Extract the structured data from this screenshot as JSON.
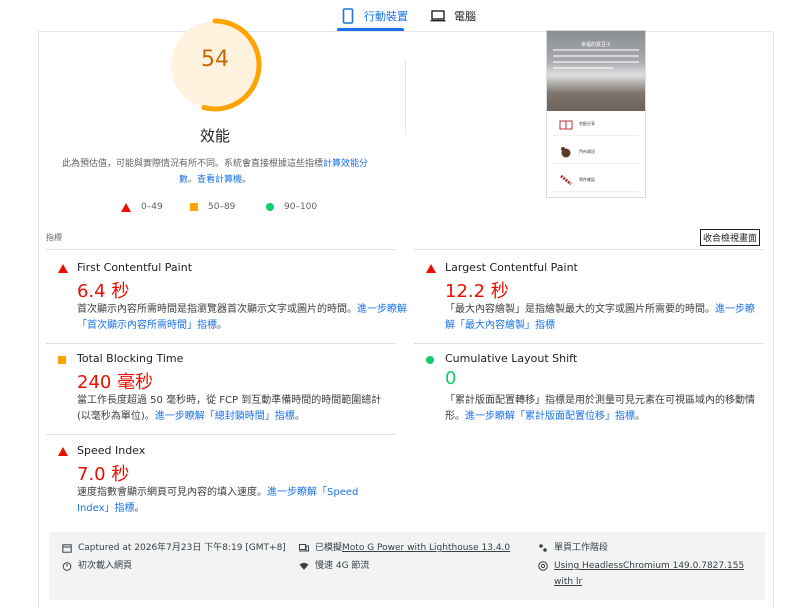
{
  "tabs": {
    "mobile_label": "行動裝置",
    "desktop_label": "電腦"
  },
  "score": {
    "value": "54",
    "fraction": 0.54,
    "title": "效能",
    "color": "#ffa400"
  },
  "note": {
    "text": "此為預估值，可能與實際情況有所不同。系統會直接根據這些指標",
    "link": "計算效能分數",
    "sep": "。",
    "link2": "查看計算機",
    "end": "。"
  },
  "legend": {
    "fail": "0–49",
    "average": "50–89",
    "pass": "90–100"
  },
  "preview": {
    "title": "幸福的貨豆子",
    "cards": [
      "宅配分享",
      "門市資訊",
      "寄件確認"
    ]
  },
  "metrics_label": "指標",
  "toggle_view": "收合檢視畫面",
  "metrics": {
    "fcp": {
      "name": "First Contentful Paint",
      "value": "6.4 秒",
      "desc": "首次顯示內容所需時間是指瀏覽器首次顯示文字或圖片的時間。",
      "link": "進一步瞭解「首次顯示內容所需時間」指標",
      "end": "。"
    },
    "lcp": {
      "name": "Largest Contentful Paint",
      "value": "12.2 秒",
      "desc": "「最大內容繪製」是指繪製最大的文字或圖片所需要的時間。",
      "link": "進一步瞭解「最大內容繪製」指標",
      "end": ""
    },
    "tbt": {
      "name": "Total Blocking Time",
      "value": "240 毫秒",
      "desc": "當工作長度超過 50 毫秒時，從 FCP 到互動準備時間的時間範圍總計 (以毫秒為單位)。",
      "link": "進一步瞭解「總封鎖時間」指標",
      "end": "。"
    },
    "cls": {
      "name": "Cumulative Layout Shift",
      "value": "0",
      "desc": "「累計版面配置轉移」指標是用於測量可見元素在可視區域內的移動情形。",
      "link": "進一步瞭解「累計版面配置位移」指標",
      "end": "。"
    },
    "si": {
      "name": "Speed Index",
      "value": "7.0 秒",
      "desc": "速度指數會顯示網頁可見內容的填入速度。",
      "link": "進一步瞭解「Speed Index」指標",
      "end": "。"
    }
  },
  "footer": {
    "captured": "Captured at 2026年7月23日 下午8:19 [GMT+8]",
    "load": "初次載入網頁",
    "device_prefix": "已模擬 ",
    "device_link": "Moto G Power with Lighthouse 13.4.0",
    "network": "慢速 4G 節流",
    "session": "單頁工作階段",
    "browser_link": "Using HeadlessChromium 149.0.7827.155 with lr"
  },
  "colors": {
    "accent": "#1a73e8",
    "fail": "#eb0f00",
    "average": "#ffa400",
    "pass": "#0cce6b"
  }
}
